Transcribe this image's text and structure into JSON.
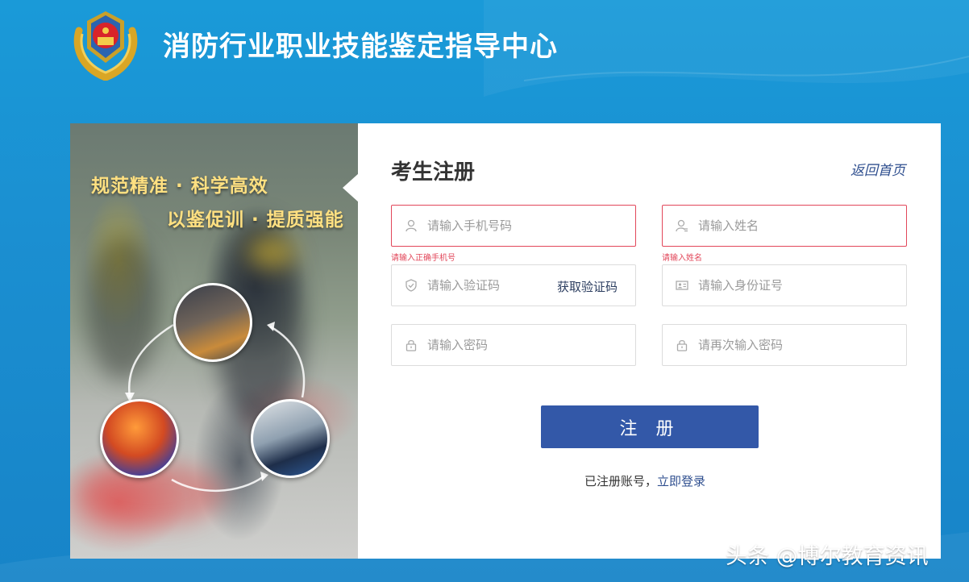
{
  "header": {
    "title": "消防行业职业技能鉴定指导中心",
    "emblem_icon": "fire-rescue-emblem-icon"
  },
  "banner": {
    "slogan_line1": "规范精准 · 科学高效",
    "slogan_line2": "以鉴促训 · 提质强能"
  },
  "form": {
    "title": "考生注册",
    "back_home": "返回首页",
    "phone": {
      "placeholder": "请输入手机号码",
      "value": "",
      "error": "请输入正确手机号",
      "icon": "user-icon"
    },
    "name": {
      "placeholder": "请输入姓名",
      "value": "",
      "error": "请输入姓名",
      "icon": "user-id-icon"
    },
    "code": {
      "placeholder": "请输入验证码",
      "value": "",
      "get_code": "获取验证码",
      "icon": "shield-icon"
    },
    "id_card": {
      "placeholder": "请输入身份证号",
      "value": "",
      "icon": "id-card-icon"
    },
    "password": {
      "placeholder": "请输入密码",
      "value": "",
      "icon": "lock-icon"
    },
    "confirm_password": {
      "placeholder": "请再次输入密码",
      "value": "",
      "icon": "lock-icon"
    },
    "submit_label": "注 册",
    "login_prompt": "已注册账号，",
    "login_link": "立即登录"
  },
  "colors": {
    "background": "#1a9ad8",
    "primary_button": "#3358a8",
    "error": "#e2475a",
    "link": "#2f4f8f",
    "slogan": "#ffe081"
  },
  "watermark": "头条 @博尔教育资讯"
}
